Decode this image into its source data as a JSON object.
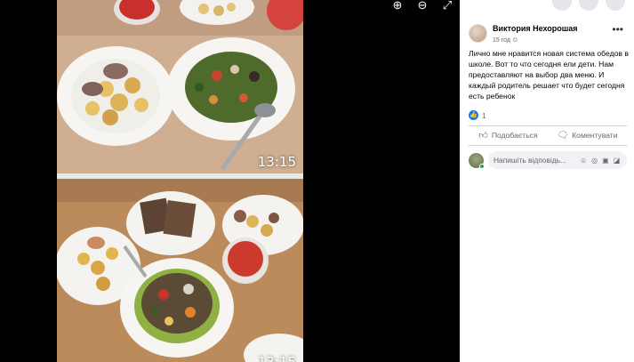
{
  "viewer": {
    "tools": [
      {
        "icon": "zoom-in-icon",
        "glyph": "⊕"
      },
      {
        "icon": "zoom-out-icon",
        "glyph": "⊖"
      },
      {
        "icon": "fullscreen-icon",
        "glyph": "⤢"
      }
    ],
    "photos": [
      {
        "time": "13:15"
      },
      {
        "time": "13:15"
      }
    ]
  },
  "post": {
    "author": "Виктория Нехорошая",
    "time": "15 год",
    "privacy_icon": "public-globe-icon",
    "text": "Лично мне нравится новая система обедов в школе. Вот то что сегодня ели дети. Нам предоставляют на выбор два меню. И каждый родитель решает что будет сегодня есть ребенок",
    "reaction_count": "1"
  },
  "actions": {
    "like_label": "Подобається",
    "comment_label": "Коментувати"
  },
  "comment": {
    "placeholder": "Напишіть відповідь..."
  }
}
